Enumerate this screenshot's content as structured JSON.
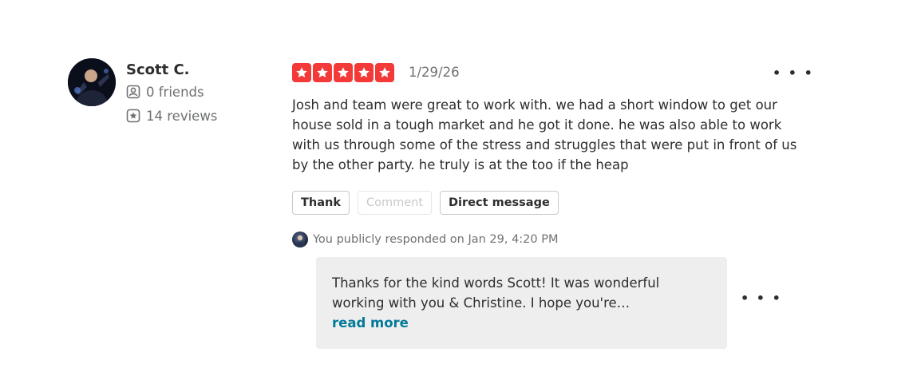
{
  "review": {
    "author": {
      "name": "Scott C.",
      "friends": "0 friends",
      "reviews": "14 reviews"
    },
    "rating": 5,
    "rating_color": "#f43939",
    "date": "1/29/26",
    "more_label": "• • •",
    "text": "Josh and team were great to work with. we had a short window to get our house sold in a tough market and he got it done. he was also able to work with us through some of the stress and struggles that were put in front of us by the other party. he truly is at the too if the heap",
    "actions": {
      "thank": "Thank",
      "comment": "Comment",
      "direct_message": "Direct message"
    }
  },
  "response": {
    "meta": "You publicly responded on Jan 29, 4:20 PM",
    "text": "Thanks for the kind words Scott! It was wonderful working with you & Christine. I hope you're…",
    "read_more": "read more",
    "link_color": "#027a97",
    "more_label": "• • •"
  }
}
